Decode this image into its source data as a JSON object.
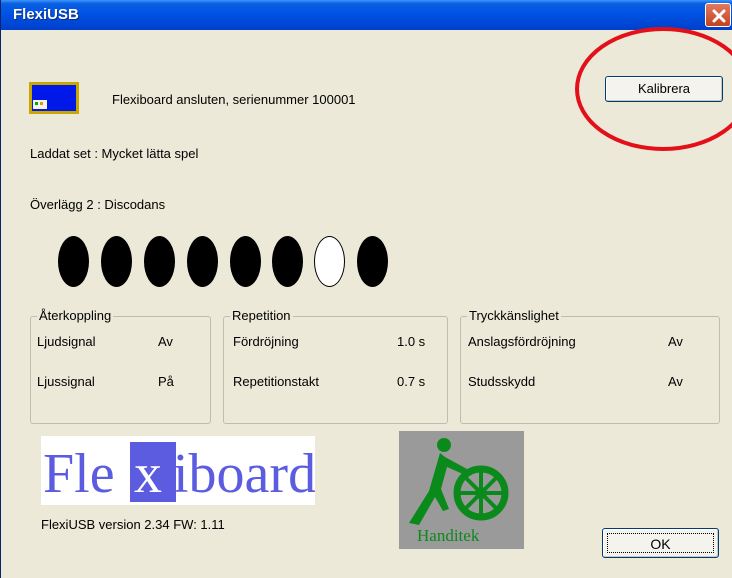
{
  "window": {
    "title": "FlexiUSB",
    "close_icon": "close-icon"
  },
  "status": {
    "connection_text": "Flexiboard ansluten, serienummer 100001",
    "calibrate_label": "Kalibrera",
    "loaded_set": "Laddat set : Mycket lätta spel",
    "overlay": "Överlägg 2 : Discodans"
  },
  "indicators": {
    "states": [
      true,
      true,
      true,
      true,
      true,
      true,
      false,
      true
    ]
  },
  "feedback": {
    "legend": "Återkoppling",
    "rows": [
      {
        "label": "Ljudsignal",
        "value": "Av"
      },
      {
        "label": "Ljussignal",
        "value": "På"
      }
    ]
  },
  "repetition": {
    "legend": "Repetition",
    "rows": [
      {
        "label": "Fördröjning",
        "value": "1.0 s"
      },
      {
        "label": "Repetitionstakt",
        "value": "0.7 s"
      }
    ]
  },
  "sensitivity": {
    "legend": "Tryckkänslighet",
    "rows": [
      {
        "label": "Anslagsfördröjning",
        "value": "Av"
      },
      {
        "label": "Studsskydd",
        "value": "Av"
      }
    ]
  },
  "footer": {
    "logo_left": "Fle",
    "logo_x": "x",
    "logo_right": "iboard",
    "handitek_text": "Handitek",
    "version_text": "FlexiUSB version 2.34   FW: 1.11",
    "ok_label": "OK"
  },
  "colors": {
    "titlebar": "#0055e5",
    "window_bg": "#ece9d8",
    "annotation": "#e3101a",
    "flexiboard_logo": "#5c5ce0",
    "handitek_green": "#0a8a1a"
  }
}
